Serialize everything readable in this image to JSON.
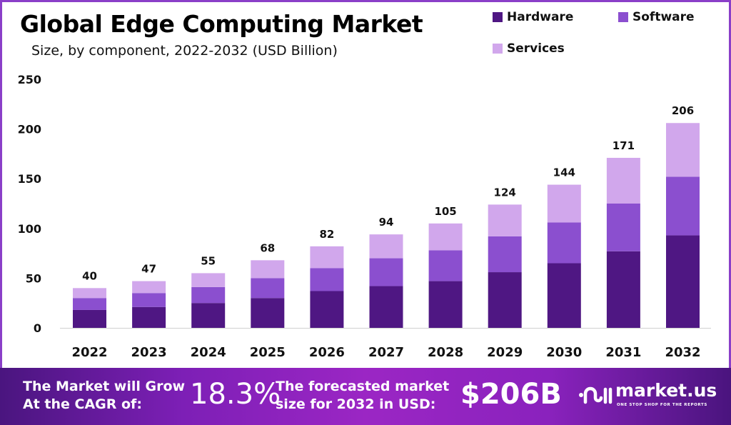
{
  "header": {
    "title": "Global Edge Computing Market",
    "subtitle": "Size, by component, 2022-2032 (USD Billion)"
  },
  "legend": [
    {
      "name": "Hardware",
      "color": "#4f1783"
    },
    {
      "name": "Software",
      "color": "#8b4fcf"
    },
    {
      "name": "Services",
      "color": "#d1a7ec"
    }
  ],
  "chart_data": {
    "type": "bar",
    "stacked": true,
    "title": "Global Edge Computing Market",
    "subtitle": "Size, by component, 2022-2032 (USD Billion)",
    "xlabel": "",
    "ylabel": "",
    "ylim": [
      0,
      250
    ],
    "yticks": [
      0,
      50,
      100,
      150,
      200,
      250
    ],
    "grid": false,
    "legend_position": "top-right",
    "categories": [
      "2022",
      "2023",
      "2024",
      "2025",
      "2026",
      "2027",
      "2028",
      "2029",
      "2030",
      "2031",
      "2032"
    ],
    "series": [
      {
        "name": "Hardware",
        "color": "#4f1783",
        "values": [
          18,
          21,
          25,
          30,
          37,
          42,
          47,
          56,
          65,
          77,
          93
        ]
      },
      {
        "name": "Software",
        "color": "#8b4fcf",
        "values": [
          12,
          14,
          16,
          20,
          23,
          28,
          31,
          36,
          41,
          48,
          59
        ]
      },
      {
        "name": "Services",
        "color": "#d1a7ec",
        "values": [
          10,
          12,
          14,
          18,
          22,
          24,
          27,
          32,
          38,
          46,
          54
        ]
      }
    ],
    "totals": [
      40,
      47,
      55,
      68,
      82,
      94,
      105,
      124,
      144,
      171,
      206
    ]
  },
  "banner": {
    "cagr_label_line1": "The Market will Grow",
    "cagr_label_line2": "At the CAGR of:",
    "cagr_value": "18.3%",
    "forecast_label_line1": "The forecasted market",
    "forecast_label_line2": "size for 2032 in USD:",
    "forecast_value": "$206B",
    "brand_name": "market.us",
    "brand_tagline": "ONE STOP SHOP FOR THE REPORTS",
    "brand_icon": "market-us-logo-icon"
  }
}
